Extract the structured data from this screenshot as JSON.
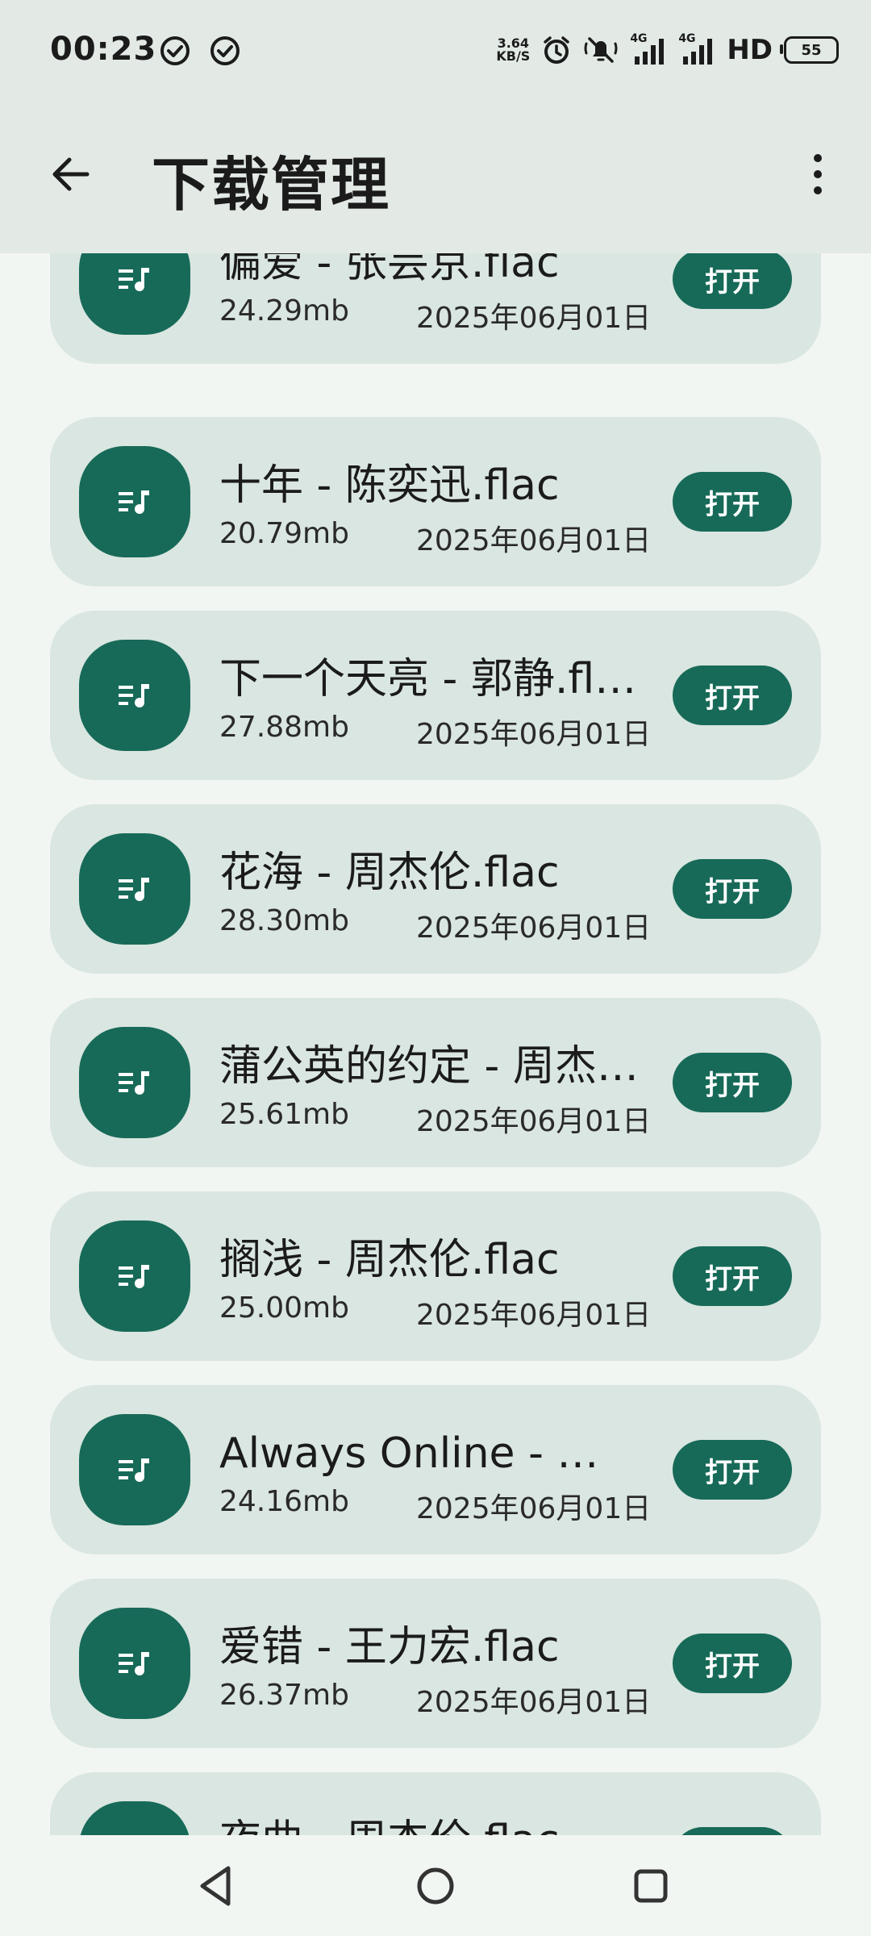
{
  "status_bar": {
    "time": "00:23",
    "net_speed_value": "3.64",
    "net_speed_unit": "KB/S",
    "network_label": "4G",
    "hd_label": "HD",
    "battery": "55"
  },
  "app_bar": {
    "title": "下载管理"
  },
  "colors": {
    "accent": "#176A58",
    "card_bg": "#DAE6E1",
    "header_bg": "#E3EAE6",
    "page_bg": "#F2F6F3"
  },
  "downloads": [
    {
      "name": "偏爱 - 张芸京.flac",
      "size": "24.29mb",
      "date": "2025年06月01日",
      "action": "打开"
    },
    {
      "name": "十年 - 陈奕迅.flac",
      "size": "20.79mb",
      "date": "2025年06月01日",
      "action": "打开"
    },
    {
      "name": "下一个天亮 - 郭静.flac",
      "size": "27.88mb",
      "date": "2025年06月01日",
      "action": "打开"
    },
    {
      "name": "花海 - 周杰伦.flac",
      "size": "28.30mb",
      "date": "2025年06月01日",
      "action": "打开"
    },
    {
      "name": "蒲公英的约定 - 周杰…",
      "size": "25.61mb",
      "date": "2025年06月01日",
      "action": "打开"
    },
    {
      "name": "搁浅 - 周杰伦.flac",
      "size": "25.00mb",
      "date": "2025年06月01日",
      "action": "打开"
    },
    {
      "name": "Always Online - 林…",
      "size": "24.16mb",
      "date": "2025年06月01日",
      "action": "打开"
    },
    {
      "name": "爱错 - 王力宏.flac",
      "size": "26.37mb",
      "date": "2025年06月01日",
      "action": "打开"
    },
    {
      "name": "夜曲 - 周杰伦.flac",
      "size": "",
      "date": "",
      "action": "打开"
    }
  ]
}
